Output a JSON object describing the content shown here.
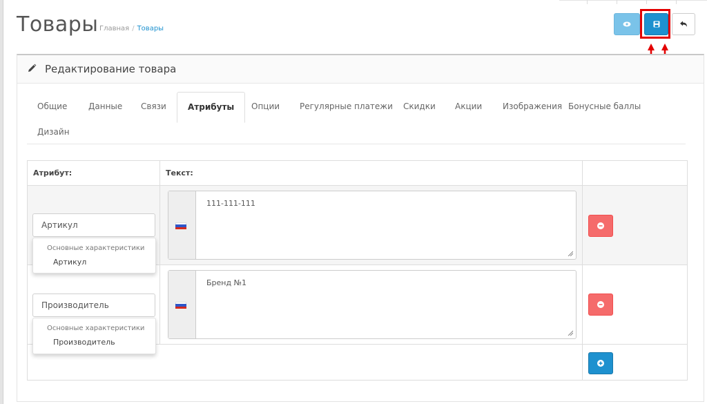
{
  "header": {
    "title": "Товары",
    "breadcrumb": [
      {
        "label": "Главная"
      },
      {
        "label": "Товары"
      }
    ]
  },
  "toolbar": {
    "view_icon": "eye-icon",
    "save_icon": "save-icon",
    "back_icon": "reply-icon"
  },
  "panel": {
    "title": "Редактирование товара",
    "icon": "pencil-icon"
  },
  "tabs": [
    {
      "label": "Общие"
    },
    {
      "label": "Данные"
    },
    {
      "label": "Связи"
    },
    {
      "label": "Атрибуты",
      "active": true
    },
    {
      "label": "Опции"
    },
    {
      "label": "Регулярные платежи"
    },
    {
      "label": "Скидки"
    },
    {
      "label": "Акции"
    },
    {
      "label": "Изображения"
    },
    {
      "label": "Бонусные баллы"
    },
    {
      "label": "Дизайн"
    }
  ],
  "attributes_table": {
    "col_attribute": "Атрибут:",
    "col_text": "Текст:",
    "rows": [
      {
        "attribute": "Артикул",
        "suggestion_group": "Основные характеристики",
        "suggestion_item": "Артикул",
        "text": "111-111-111"
      },
      {
        "attribute": "Производитель",
        "suggestion_group": "Основные характеристики",
        "suggestion_item": "Производитель",
        "text": "Бренд №1"
      }
    ]
  },
  "colors": {
    "primary": "#1e91cf",
    "info": "#7ac3e9",
    "danger": "#f56b6b",
    "highlight": "#e30000"
  }
}
